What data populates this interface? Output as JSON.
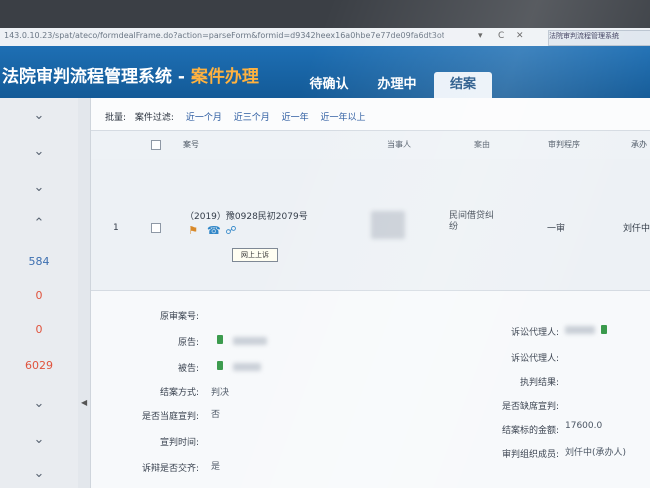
{
  "browser": {
    "url": "143.0.10.23/spat/ateco/formdealFrame.do?action=parseForm&formid=d9342heex16a0hbe7e77de09fa6dt3ot",
    "controls": [
      "▾",
      "C",
      "✕"
    ],
    "tab_label": "法院审判流程管理系统"
  },
  "header": {
    "title": "法院审判流程管理系统 - ",
    "subtitle": "案件办理",
    "tabs": [
      {
        "label": "待确认"
      },
      {
        "label": "办理中"
      },
      {
        "label": "结案"
      }
    ]
  },
  "nav": {
    "counts": [
      "584",
      "0",
      "0",
      "6029"
    ]
  },
  "filter": {
    "prefix": "批量:",
    "label": "案件过滤:",
    "options": [
      "近一个月",
      "近三个月",
      "近一年",
      "近一年以上"
    ]
  },
  "table": {
    "headers": {
      "case_no": "案号",
      "party": "当事人",
      "cause": "案由",
      "procedure": "审判程序",
      "status": "承办"
    },
    "rows": [
      {
        "index": "1",
        "case_no": "（2019）豫0928民初2079号",
        "cause": "民间借贷纠纷",
        "procedure": "一审",
        "status": "刘仟中"
      }
    ],
    "tooltip": "网上上诉"
  },
  "detail": {
    "left": [
      {
        "label": "原审案号:",
        "value": ""
      },
      {
        "label": "原告:",
        "value": ""
      },
      {
        "label": "被告:",
        "value": ""
      },
      {
        "label": "结案方式:",
        "value": "判决"
      },
      {
        "label": "是否当庭宣判:",
        "value": "否"
      },
      {
        "label": "宣判时间:",
        "value": ""
      },
      {
        "label": "诉辩是否交齐:",
        "value": "是"
      }
    ],
    "right": [
      {
        "label": "诉讼代理人:",
        "value": ""
      },
      {
        "label": "诉讼代理人:",
        "value": ""
      },
      {
        "label": "执判结果:",
        "value": ""
      },
      {
        "label": "是否缺席宣判:",
        "value": ""
      },
      {
        "label": "结案标的金额:",
        "value": "17600.0"
      },
      {
        "label": "审判组织成员:",
        "value": "刘仟中(承办人)"
      }
    ]
  },
  "colors": {
    "header_blue": "#1e6fb4",
    "subtitle_orange": "#ffb23f",
    "count_red": "#e0533d"
  }
}
